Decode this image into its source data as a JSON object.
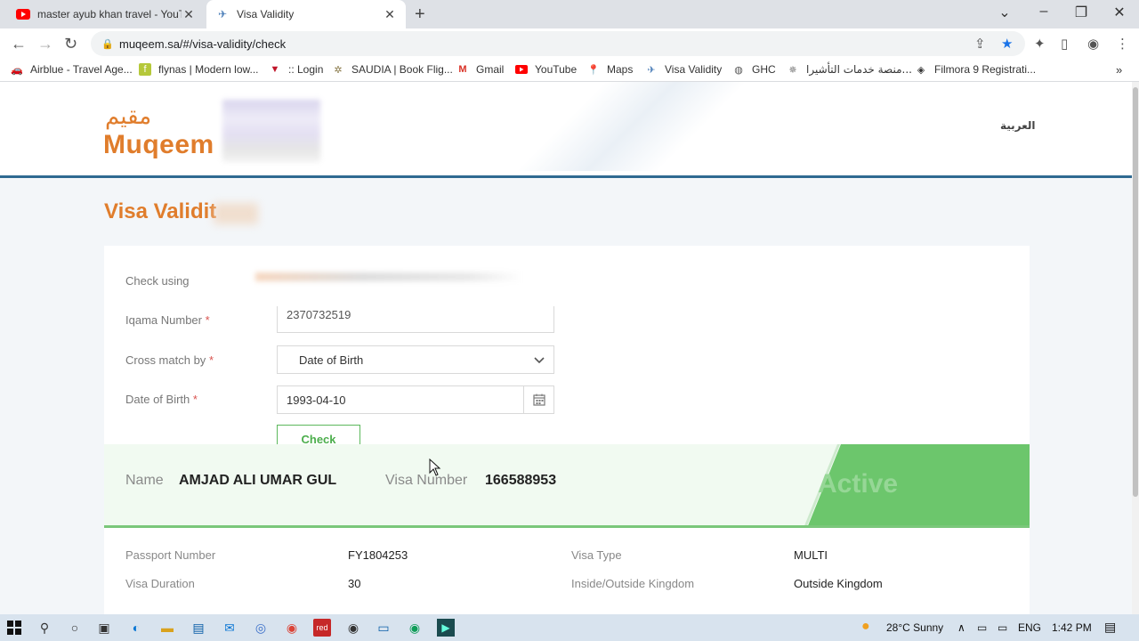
{
  "browser": {
    "tabs": [
      {
        "title": "master ayub khan travel - YouTu",
        "active": false
      },
      {
        "title": "Visa Validity",
        "active": true
      }
    ],
    "url": "muqeem.sa/#/visa-validity/check",
    "bookmarks": [
      "Airblue - Travel Age...",
      "flynas | Modern low...",
      ":: Login",
      "SAUDIA | Book Flig...",
      "Gmail",
      "YouTube",
      "Maps",
      "Visa Validity",
      "GHC",
      "منصة خدمات التأشيرا...",
      "Filmora 9 Registrati..."
    ]
  },
  "header": {
    "logo_ar": "مقيم",
    "logo_en": "Muqeem",
    "language_link": "العربية"
  },
  "page": {
    "title": "Visa Validit"
  },
  "form": {
    "check_using_label": "Check using",
    "iqama_label": "Iqama Number",
    "iqama_value": "2370732519",
    "cross_match_label": "Cross match by",
    "cross_match_value": "Date of Birth",
    "dob_label": "Date of Birth",
    "dob_value": "1993-04-10",
    "required_mark": "*",
    "check_button": "Check"
  },
  "result": {
    "name_label": "Name",
    "name_value": "AMJAD ALI UMAR GUL",
    "visa_number_label": "Visa Number",
    "visa_number_value": "166588953",
    "status": "Active"
  },
  "details": {
    "passport_number_label": "Passport Number",
    "passport_number_value": "FY1804253",
    "visa_type_label": "Visa Type",
    "visa_type_value": "MULTI",
    "visa_duration_label": "Visa Duration",
    "visa_duration_value": "30",
    "inside_outside_label": "Inside/Outside Kingdom",
    "inside_outside_value": "Outside Kingdom"
  },
  "taskbar": {
    "weather": "28°C  Sunny",
    "language": "ENG",
    "time": "1:42 PM"
  },
  "colors": {
    "brand_orange": "#e07d2c",
    "header_border": "#2f6a91",
    "active_green": "#6cc66c"
  }
}
